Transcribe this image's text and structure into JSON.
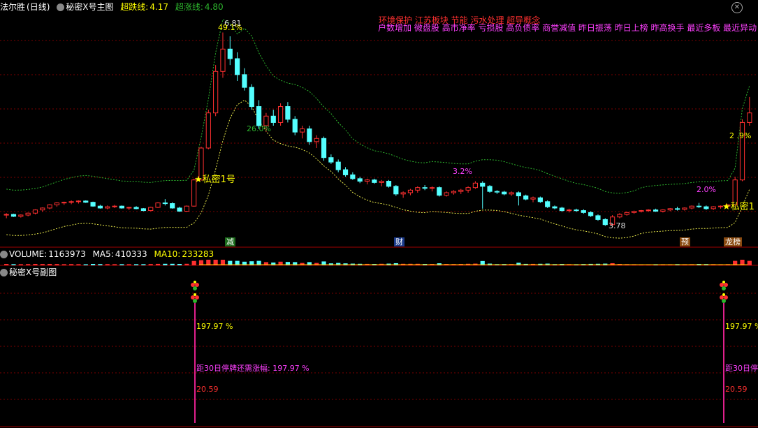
{
  "header": {
    "stock_name": "法尔胜",
    "period": "(日线)",
    "indicator_name": "秘密X号主图",
    "super_fall_label": "超跌线:",
    "super_fall_value": "4.17",
    "super_rise_label": "超涨线:",
    "super_rise_value": "4.80"
  },
  "concept_tags_row1": "环境保护 江苏板块 节能 污水处理 超导概念",
  "concept_tags_row2": "户数增加 微盘股 高市净率 亏损股 高负债率 商誉减值 昨日振荡 昨日上榜 昨高换手 最近多板 最近异动 i",
  "annotations": {
    "high_price": "6.81",
    "pct_peak": "49.1%",
    "pct_mid": "26.0%",
    "pct_32": "3.2%",
    "pct_20": "2.0%",
    "pct_right": "2 .9%",
    "low_price": "3.78",
    "signal_1": "私密1号",
    "signal_2": "私密1"
  },
  "event_badges": {
    "reduce": "减",
    "finance": "财",
    "forecast": "预",
    "list": "龙榜"
  },
  "volume_header": {
    "volume_label": "VOLUME:",
    "volume_value": "1163973",
    "ma5_label": "MA5:",
    "ma5_value": "410333",
    "ma10_label": "MA10:",
    "ma10_value": "233283"
  },
  "sub_chart": {
    "title": "秘密X号副图",
    "left_pct": "197.97 %",
    "left_need": "距30日停牌还需涨幅: 197.97 %",
    "left_price": "20.59",
    "right_pct": "197.97 %",
    "right_need": "距30日停",
    "right_price": "20.59"
  },
  "colors": {
    "up": "#ff3030",
    "down": "#54ffff",
    "upper_band": "#2db52d",
    "lower_band": "#e8e84a",
    "grid": "#7a0000",
    "magenta": "#ff40ff",
    "yellow": "#ffff00",
    "pink_line": "#e0208c"
  },
  "chart_data": {
    "type": "candlestick",
    "ylim": [
      3.6,
      7.1
    ],
    "series": [
      {
        "name": "candles",
        "values": [
          [
            3.95,
            3.98,
            3.9,
            3.96
          ],
          [
            3.96,
            3.97,
            3.92,
            3.93
          ],
          [
            3.93,
            3.96,
            3.91,
            3.95
          ],
          [
            3.95,
            3.99,
            3.93,
            3.98
          ],
          [
            3.98,
            4.04,
            3.96,
            4.03
          ],
          [
            4.03,
            4.07,
            4.0,
            4.06
          ],
          [
            4.06,
            4.12,
            4.04,
            4.11
          ],
          [
            4.11,
            4.15,
            4.08,
            4.14
          ],
          [
            4.14,
            4.16,
            4.11,
            4.15
          ],
          [
            4.15,
            4.18,
            4.12,
            4.16
          ],
          [
            4.16,
            4.18,
            4.13,
            4.17
          ],
          [
            4.17,
            4.18,
            4.14,
            4.15
          ],
          [
            4.15,
            4.16,
            4.08,
            4.09
          ],
          [
            4.09,
            4.11,
            4.05,
            4.06
          ],
          [
            4.06,
            4.1,
            4.04,
            4.08
          ],
          [
            4.08,
            4.11,
            4.06,
            4.09
          ],
          [
            4.09,
            4.1,
            4.05,
            4.06
          ],
          [
            4.06,
            4.08,
            4.03,
            4.07
          ],
          [
            4.07,
            4.09,
            4.04,
            4.05
          ],
          [
            4.05,
            4.06,
            4.01,
            4.02
          ],
          [
            4.02,
            4.08,
            4.01,
            4.07
          ],
          [
            4.07,
            4.15,
            4.06,
            4.14
          ],
          [
            4.14,
            4.2,
            4.1,
            4.13
          ],
          [
            4.13,
            4.15,
            4.05,
            4.06
          ],
          [
            4.06,
            4.08,
            4.0,
            4.01
          ],
          [
            4.01,
            4.1,
            4.0,
            4.09
          ],
          [
            4.09,
            4.52,
            4.08,
            4.5
          ],
          [
            4.5,
            5.02,
            4.49,
            5.0
          ],
          [
            5.0,
            5.6,
            4.98,
            5.55
          ],
          [
            5.55,
            6.3,
            5.5,
            6.2
          ],
          [
            6.2,
            6.81,
            6.1,
            6.55
          ],
          [
            6.55,
            6.75,
            6.3,
            6.4
          ],
          [
            6.4,
            6.5,
            6.05,
            6.15
          ],
          [
            6.15,
            6.25,
            5.9,
            5.95
          ],
          [
            5.95,
            6.0,
            5.6,
            5.65
          ],
          [
            5.65,
            5.75,
            5.3,
            5.35
          ],
          [
            5.35,
            5.55,
            5.25,
            5.5
          ],
          [
            5.5,
            5.6,
            5.35,
            5.4
          ],
          [
            5.4,
            5.7,
            5.35,
            5.65
          ],
          [
            5.65,
            5.72,
            5.4,
            5.45
          ],
          [
            5.45,
            5.5,
            5.2,
            5.25
          ],
          [
            5.25,
            5.35,
            5.15,
            5.3
          ],
          [
            5.3,
            5.35,
            5.05,
            5.1
          ],
          [
            5.1,
            5.2,
            5.0,
            5.15
          ],
          [
            5.15,
            5.18,
            4.8,
            4.85
          ],
          [
            4.85,
            4.9,
            4.75,
            4.78
          ],
          [
            4.78,
            4.82,
            4.62,
            4.66
          ],
          [
            4.66,
            4.7,
            4.55,
            4.58
          ],
          [
            4.58,
            4.62,
            4.5,
            4.52
          ],
          [
            4.52,
            4.55,
            4.45,
            4.48
          ],
          [
            4.48,
            4.52,
            4.43,
            4.5
          ],
          [
            4.5,
            4.52,
            4.44,
            4.46
          ],
          [
            4.46,
            4.5,
            4.4,
            4.48
          ],
          [
            4.48,
            4.5,
            4.38,
            4.4
          ],
          [
            4.4,
            4.42,
            4.25,
            4.28
          ],
          [
            4.28,
            4.32,
            4.22,
            4.3
          ],
          [
            4.3,
            4.36,
            4.26,
            4.34
          ],
          [
            4.34,
            4.4,
            4.3,
            4.38
          ],
          [
            4.38,
            4.42,
            4.34,
            4.37
          ],
          [
            4.37,
            4.4,
            4.32,
            4.38
          ],
          [
            4.38,
            4.4,
            4.24,
            4.26
          ],
          [
            4.26,
            4.32,
            4.24,
            4.3
          ],
          [
            4.3,
            4.34,
            4.27,
            4.32
          ],
          [
            4.32,
            4.36,
            4.28,
            4.34
          ],
          [
            4.34,
            4.4,
            4.3,
            4.38
          ],
          [
            4.38,
            4.48,
            4.36,
            4.45
          ],
          [
            4.45,
            4.48,
            4.05,
            4.4
          ],
          [
            4.4,
            4.42,
            4.3,
            4.32
          ],
          [
            4.32,
            4.34,
            4.28,
            4.31
          ],
          [
            4.31,
            4.33,
            4.26,
            4.28
          ],
          [
            4.28,
            4.32,
            4.25,
            4.3
          ],
          [
            4.3,
            4.32,
            4.1,
            4.25
          ],
          [
            4.25,
            4.27,
            4.18,
            4.2
          ],
          [
            4.2,
            4.24,
            4.15,
            4.22
          ],
          [
            4.22,
            4.24,
            4.14,
            4.16
          ],
          [
            4.16,
            4.18,
            4.06,
            4.08
          ],
          [
            4.08,
            4.1,
            4.04,
            4.06
          ],
          [
            4.06,
            4.08,
            4.0,
            4.02
          ],
          [
            4.02,
            4.05,
            3.99,
            4.03
          ],
          [
            4.03,
            4.05,
            4.0,
            4.02
          ],
          [
            4.02,
            4.04,
            3.97,
            3.99
          ],
          [
            3.99,
            4.01,
            3.92,
            3.94
          ],
          [
            3.94,
            3.96,
            3.86,
            3.88
          ],
          [
            3.88,
            3.9,
            3.78,
            3.8
          ],
          [
            3.8,
            3.95,
            3.78,
            3.92
          ],
          [
            3.92,
            3.98,
            3.9,
            3.96
          ],
          [
            3.96,
            4.0,
            3.94,
            3.99
          ],
          [
            3.99,
            4.02,
            3.97,
            4.01
          ],
          [
            4.01,
            4.03,
            3.99,
            4.02
          ],
          [
            4.02,
            4.04,
            4.0,
            4.03
          ],
          [
            4.03,
            4.05,
            4.0,
            4.01
          ],
          [
            4.01,
            4.04,
            3.99,
            4.03
          ],
          [
            4.03,
            4.06,
            4.01,
            4.05
          ],
          [
            4.05,
            4.08,
            4.02,
            4.04
          ],
          [
            4.04,
            4.07,
            4.02,
            4.06
          ],
          [
            4.06,
            4.1,
            4.04,
            4.09
          ],
          [
            4.09,
            4.14,
            4.06,
            4.08
          ],
          [
            4.08,
            4.1,
            4.03,
            4.05
          ],
          [
            4.05,
            4.09,
            4.03,
            4.08
          ],
          [
            4.08,
            4.1,
            4.05,
            4.09
          ],
          [
            4.09,
            4.12,
            4.06,
            4.11
          ],
          [
            4.11,
            4.55,
            4.1,
            4.5
          ],
          [
            4.5,
            5.45,
            4.48,
            5.4
          ],
          [
            5.4,
            5.8,
            5.35,
            5.55
          ]
        ]
      }
    ]
  }
}
